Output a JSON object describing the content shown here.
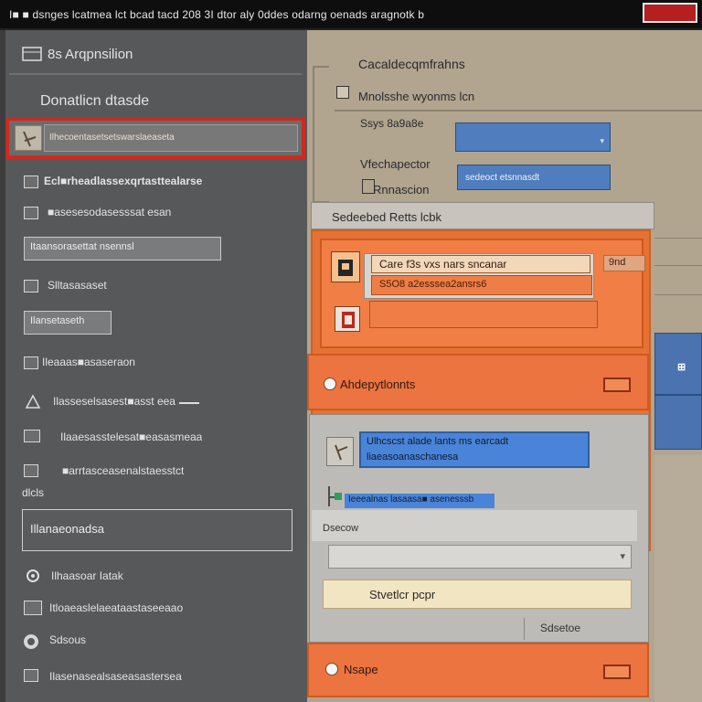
{
  "window": {
    "title": "I■ ■ dsnges lcatmea lct bcad tacd 208 3I dtor aly 0ddes odarng oenads aragnotk b"
  },
  "sidebar": {
    "header": "8s Arqpnsilion",
    "section_label": "Donatlicn dtasde",
    "selected_item": "Ilhecoentasetsetswarslaeaseta",
    "items": [
      {
        "label": "Ecl■rheadlassexqrtasttealarse",
        "icon": "doc-icon"
      },
      {
        "label": "■asesesodasesssat esan",
        "icon": "folder-icon"
      },
      {
        "label": "Itaansorasettat nsennsl",
        "boxed": true
      },
      {
        "label": "Slltasasaset",
        "icon": "doc-icon"
      },
      {
        "label": "Ilansetaseth",
        "boxed": true
      },
      {
        "label": "Ileaaas■asaseraon",
        "icon": "doc-icon"
      },
      {
        "label": "Ilasseselsasest■asst eea",
        "icon": "tree-icon"
      },
      {
        "label": "Ilaaesasstelesat■easasmeaa",
        "icon": "monitor-icon"
      },
      {
        "label": "■arrtasceasenalstaesstct",
        "icon": "doc-icon"
      },
      {
        "label": "dlcls",
        "icon": ""
      },
      {
        "label": "Illanaeonadsa",
        "boxed": true,
        "large": true
      },
      {
        "label": "Ilhaasoar Iatak",
        "icon": "gear-icon"
      },
      {
        "label": "Itloaeaslelaeataastaseeaao",
        "icon": "monitor-icon"
      },
      {
        "label": "Sdsous",
        "icon": "globe-icon"
      },
      {
        "label": "Ilasenasealsaseasastersea",
        "icon": "doc-icon"
      }
    ]
  },
  "main": {
    "heading": "Cacaldecqmfrahns",
    "checkbox_label": "Mnolsshe wyonms lcn",
    "field1_label": "Ssys 8a9a8e",
    "field1_value": "",
    "field2_label": "Vfechapector",
    "field2_value": "sedeoct etsnnasdt",
    "field3_label": "Rnnascion"
  },
  "dialog": {
    "title": "Sedeebed Retts lcbk",
    "row1_text": "Care f3s vxs  nars sncanar",
    "row1_sub": "S5O8 a2esssea2ansrs6",
    "row1_side": "9nd",
    "option_label": "Ahdepytlonnts",
    "blue_field_text": "Ulhcscst alade lants ms earcadt",
    "blue_field_sub": "liaeasoanaschanesa",
    "selected_row_text": "Ieeealnas lasaasa■ asenesssb",
    "field_label": "Dsecow",
    "field_value": "",
    "yellow_text": "Stvetlcr pcpr",
    "footer_label": "Sdsetoe",
    "bottom_label": "Nsape"
  },
  "colors": {
    "accent_orange": "#e57234",
    "selection_red": "#cc2a20",
    "blue_field": "#4f7dbd"
  }
}
